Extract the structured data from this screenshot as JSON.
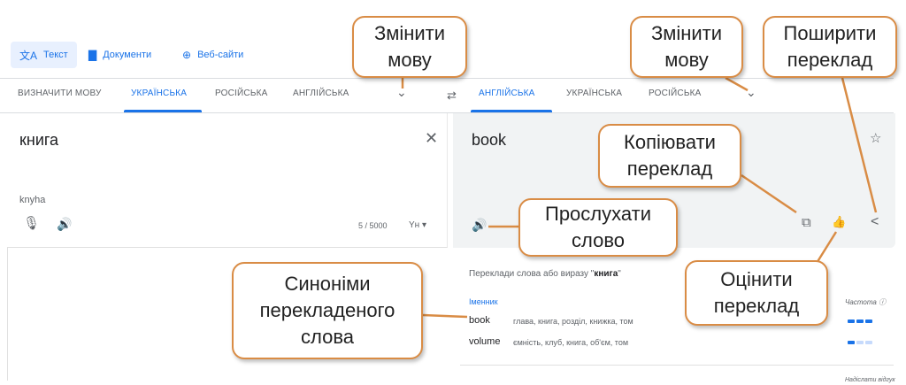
{
  "modes": [
    {
      "label": "Текст",
      "icon": "translate-icon",
      "active": true
    },
    {
      "label": "Документи",
      "icon": "document-icon",
      "active": false
    },
    {
      "label": "Веб-сайти",
      "icon": "globe-icon",
      "active": false
    }
  ],
  "source_langs": [
    "ВИЗНАЧИТИ МОВУ",
    "УКРАЇНСЬКА",
    "РОСІЙСЬКА",
    "АНГЛІЙСЬКА"
  ],
  "target_langs": [
    "АНГЛІЙСЬКА",
    "УКРАЇНСЬКА",
    "РОСІЙСЬКА"
  ],
  "source": {
    "text": "книга",
    "transliteration": "knyha",
    "counter": "5 / 5000",
    "input_tool": "Yн"
  },
  "target": {
    "text": "book"
  },
  "dictionary": {
    "title_prefix": "Переклади слова або виразу \"",
    "title_word": "книга",
    "title_suffix": "\"",
    "part_of_speech": "Іменник",
    "frequency_label": "Частота ⓘ",
    "entries": [
      {
        "word": "book",
        "synonyms": "глава, книга, розділ, книжка, том",
        "frequency": 3
      },
      {
        "word": "volume",
        "synonyms": "ємність, клуб, книга, об'єм, том",
        "frequency": 1
      }
    ],
    "feedback": "Надіслати відгук"
  },
  "callouts": {
    "change_lang_1": "Змінити мову",
    "change_lang_2": "Змінити мову",
    "share": "Поширити переклад",
    "copy": "Копіювати переклад",
    "listen": "Прослухати слово",
    "synonyms": "Синоніми перекладеного слова",
    "rate": "Оцінити переклад"
  },
  "colors": {
    "accent": "#1a73e8",
    "callout_border": "#d98c45"
  }
}
